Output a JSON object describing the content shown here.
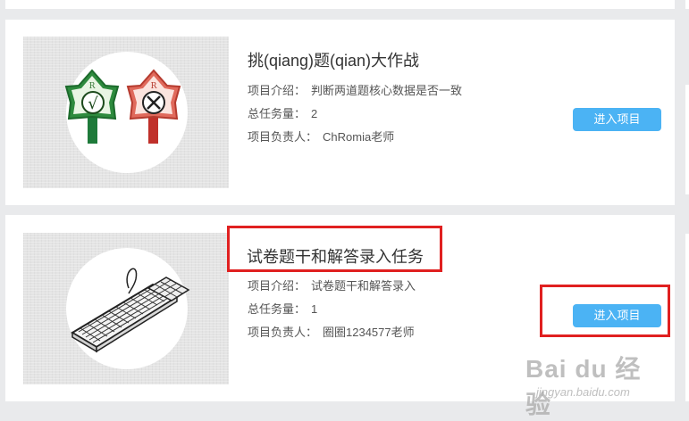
{
  "projects": [
    {
      "title": "挑(qiang)题(qian)大作战",
      "intro_label": "项目介绍：",
      "intro_value": "判断两道题核心数据是否一致",
      "tasks_label": "总任务量：",
      "tasks_value": "2",
      "owner_label": "项目负责人：",
      "owner_value": "ChRomia老师",
      "button_label": "进入项目",
      "thumbnail": "check-and-cross-signs-icon"
    },
    {
      "title": "试卷题干和解答录入任务",
      "intro_label": "项目介绍：",
      "intro_value": "试卷题干和解答录入",
      "tasks_label": "总任务量：",
      "tasks_value": "1",
      "owner_label": "项目负责人：",
      "owner_value": "圈圈1234577老师",
      "button_label": "进入项目",
      "thumbnail": "keyboard-icon"
    }
  ],
  "colors": {
    "button": "#4bb3f4",
    "highlight": "#e02020",
    "background": "#e9eaec"
  },
  "watermark": {
    "main": "Bai du 经验",
    "sub": "jingyan.baidu.com"
  }
}
